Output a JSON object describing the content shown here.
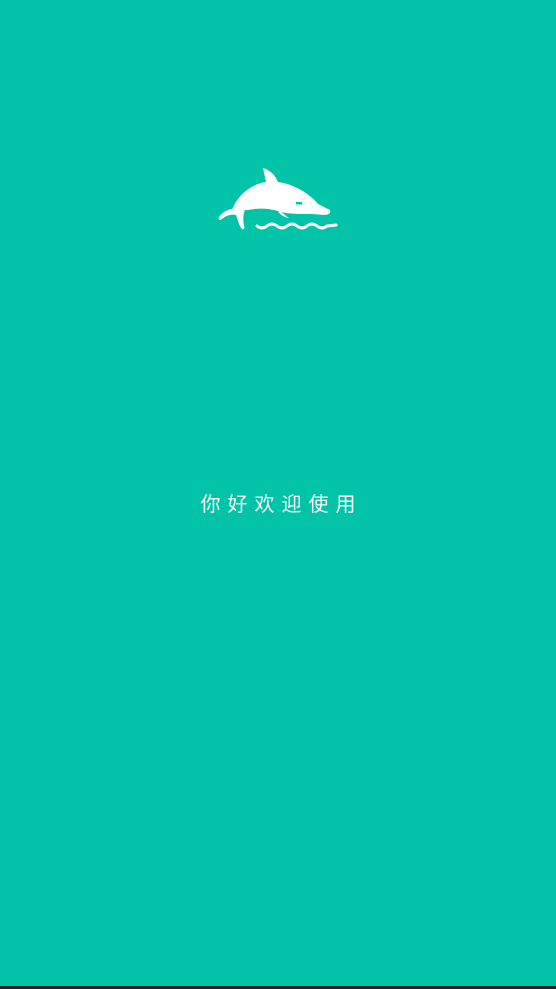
{
  "splash": {
    "welcome_text": "你好欢迎使用",
    "logo_icon": "dolphin-icon"
  },
  "colors": {
    "background": "#00c3a8",
    "foreground": "#ffffff"
  }
}
